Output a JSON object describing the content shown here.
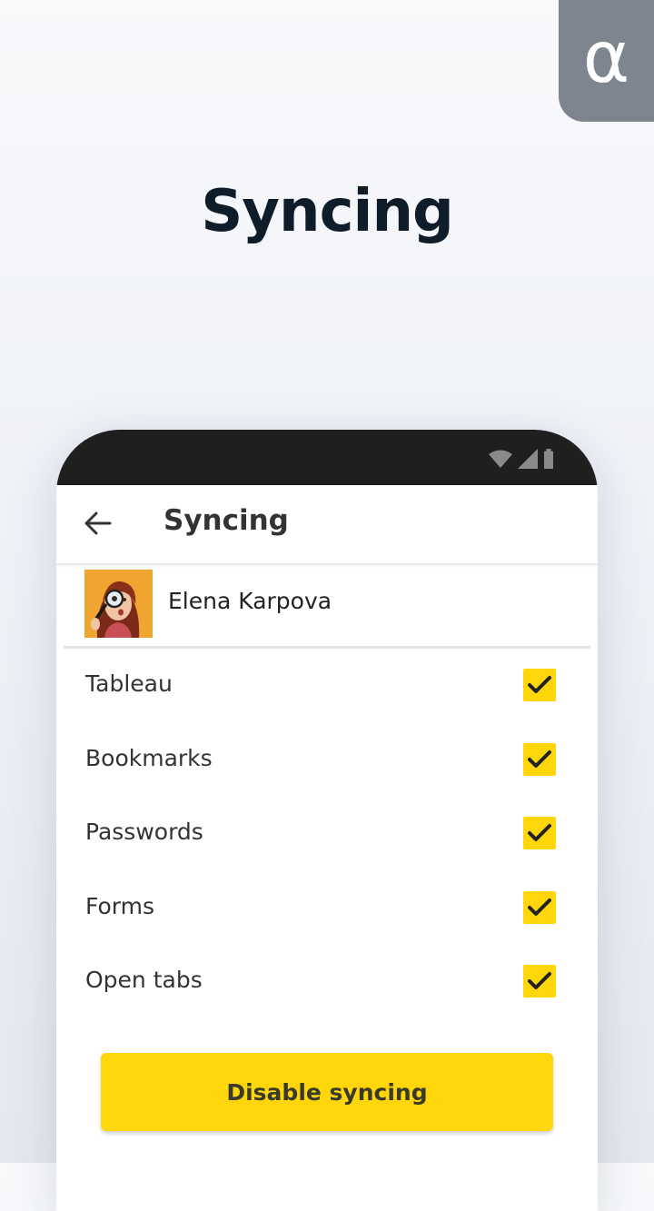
{
  "badge": {
    "symbol": "α"
  },
  "promo": {
    "title": "Syncing"
  },
  "phone": {
    "app_bar": {
      "title": "Syncing"
    },
    "account": {
      "name": "Elena Karpova"
    },
    "sync_items": [
      {
        "label": "Tableau",
        "checked": true
      },
      {
        "label": "Bookmarks",
        "checked": true
      },
      {
        "label": "Passwords",
        "checked": true
      },
      {
        "label": "Forms",
        "checked": true
      },
      {
        "label": "Open tabs",
        "checked": true
      }
    ],
    "disable_button": {
      "label": "Disable syncing"
    }
  },
  "colors": {
    "accent_yellow": "#ffd60a",
    "status_bar": "#1f1f1f",
    "badge_gray": "#7f858f",
    "title_dark": "#0f1d2b"
  }
}
